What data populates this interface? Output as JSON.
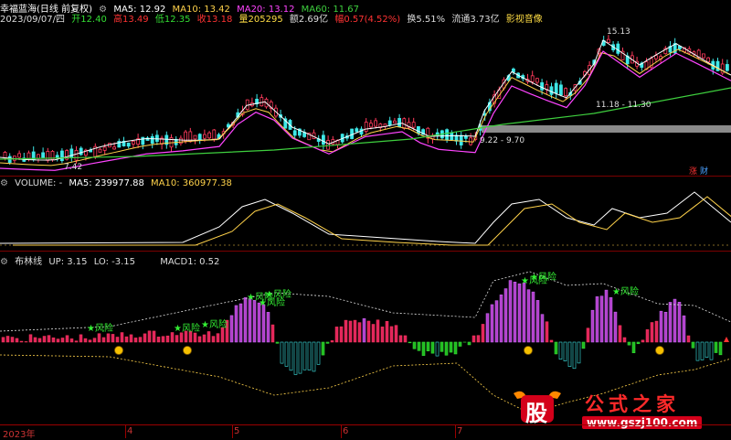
{
  "header": {
    "stock_name": "幸福蓝海(日线 前复权)",
    "ma_labels": [
      {
        "text": "MA5: 12.92",
        "color": "#ffffff"
      },
      {
        "text": "MA10: 13.42",
        "color": "#ffd24a"
      },
      {
        "text": "MA20: 13.12",
        "color": "#ff44ff"
      },
      {
        "text": "MA60: 11.67",
        "color": "#3ecf3e"
      }
    ],
    "info": [
      {
        "text": "2023/09/07/四",
        "color": "#dddddd"
      },
      {
        "text": "开12.40",
        "color": "#33dd33"
      },
      {
        "text": "高13.49",
        "color": "#ff3333"
      },
      {
        "text": "低12.35",
        "color": "#33dd33"
      },
      {
        "text": "收13.18",
        "color": "#ff3333"
      },
      {
        "text": "量205295",
        "color": "#ffdd44"
      },
      {
        "text": "额2.69亿",
        "color": "#dddddd"
      },
      {
        "text": "幅0.57(4.52%)",
        "color": "#ff3333"
      },
      {
        "text": "换5.51%",
        "color": "#dddddd"
      },
      {
        "text": "流通3.73亿",
        "color": "#dddddd"
      },
      {
        "text": "影视音像",
        "color": "#ffdd44"
      }
    ]
  },
  "price_annotations": {
    "high": "15.13",
    "box_upper": "11.18 - 11.30",
    "box_lower": "9.22 - 9.70",
    "low": "7.42"
  },
  "markers": {
    "zhang": "涨",
    "cai": "财"
  },
  "volume_panel": {
    "title": "VOLUME: -",
    "ma5": "MA5: 239977.88",
    "ma10": "MA10: 360977.38"
  },
  "boll_panel": {
    "title": "布林线",
    "up": "UP: 3.15",
    "lo": "LO: -3.15",
    "macd": "MACD1: 0.52",
    "risk_label": "风险"
  },
  "time_axis": {
    "labels": [
      "2023年",
      "4",
      "5",
      "6",
      "7"
    ]
  },
  "watermark": {
    "logo_char": "股",
    "site_name": "公式之家",
    "url": "www.gszj100.com"
  },
  "colors": {
    "up": "#ff3a5c",
    "down": "#3ee8e8",
    "bg": "#000000",
    "grid": "#7a0000"
  }
}
